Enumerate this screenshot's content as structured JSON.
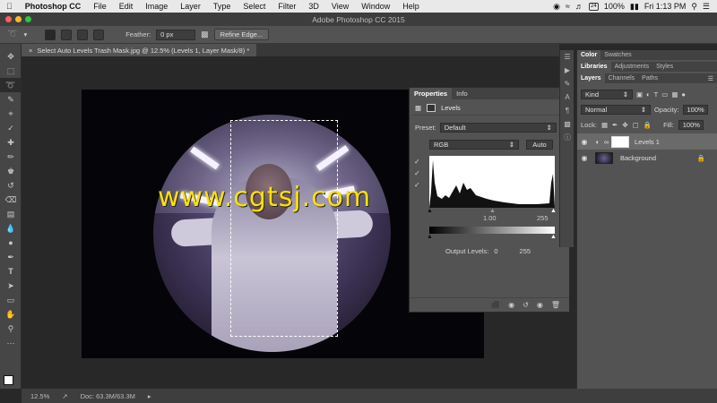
{
  "menubar": {
    "apple": "",
    "app": "Photoshop CC",
    "items": [
      "File",
      "Edit",
      "Image",
      "Layer",
      "Type",
      "Select",
      "Filter",
      "3D",
      "View",
      "Window",
      "Help"
    ],
    "battery": "100%",
    "day": "24",
    "clock": "Fri 1:13 PM"
  },
  "titlebar": {
    "title": "Adobe Photoshop CC 2015"
  },
  "options": {
    "feather_label": "Feather:",
    "feather_value": "0 px",
    "refine_label": "Refine Edge..."
  },
  "document": {
    "tab": "Select Auto Levels Trash Mask.jpg @ 12.5% (Levels 1, Layer Mask/8) *",
    "watermark": "www.cgtsj.com"
  },
  "properties": {
    "tabs": [
      "Properties",
      "Info"
    ],
    "title": "Levels",
    "preset_label": "Preset:",
    "preset_value": "Default",
    "channel": "RGB",
    "auto_label": "Auto",
    "input_mid": "1.00",
    "input_high": "255",
    "output_label": "Output Levels:",
    "output_low": "0",
    "output_high": "255"
  },
  "panels": {
    "top_tabs": [
      "Color",
      "Swatches"
    ],
    "mid_tabs": [
      "Libraries",
      "Adjustments",
      "Styles"
    ],
    "layer_tabs": [
      "Layers",
      "Channels",
      "Paths"
    ],
    "kind_label": "Kind",
    "blend_mode": "Normal",
    "opacity_label": "Opacity:",
    "opacity_value": "100%",
    "lock_label": "Lock:",
    "fill_label": "Fill:",
    "fill_value": "100%",
    "layers": [
      {
        "name": "Levels 1"
      },
      {
        "name": "Background"
      }
    ]
  },
  "status": {
    "zoom": "12.5%",
    "doc": "Doc: 63.3M/63.3M"
  }
}
